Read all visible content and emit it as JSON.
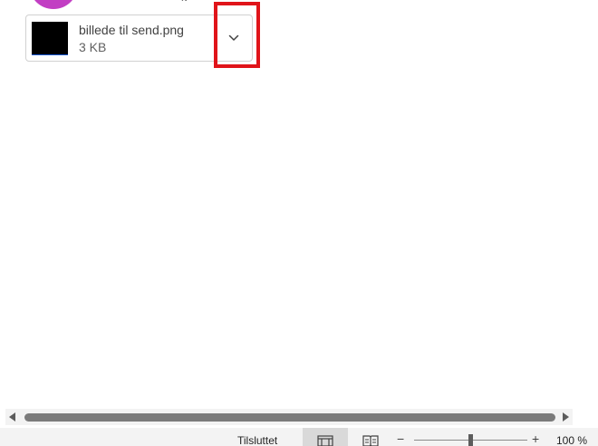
{
  "message": {
    "sender_fragment": "g"
  },
  "attachment": {
    "file_name": "billede til send.png",
    "file_size": "3 KB",
    "menu_icon": "chevron-down-icon"
  },
  "highlight": {
    "color": "#e0141a"
  },
  "statusbar": {
    "status_text": "Tilsluttet",
    "view_normal_icon": "normal-view-icon",
    "view_reading_icon": "reading-view-icon",
    "zoom_minus": "−",
    "zoom_plus": "+",
    "zoom_level": "100 %",
    "zoom_percent": 100
  }
}
